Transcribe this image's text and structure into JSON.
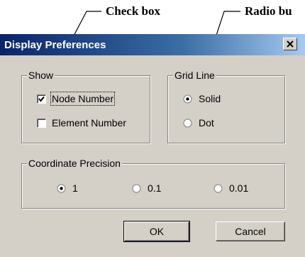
{
  "annotations": {
    "check_box_label": "Check box",
    "radio_label": "Radio bu"
  },
  "dialog": {
    "title": "Display Preferences",
    "close_glyph": "×",
    "show_group": {
      "label": "Show",
      "items": [
        {
          "label": "Node Number",
          "checked": true
        },
        {
          "label": "Element Number",
          "checked": false
        }
      ]
    },
    "grid_group": {
      "label": "Grid Line",
      "options": [
        {
          "label": "Solid",
          "selected": true
        },
        {
          "label": "Dot",
          "selected": false
        }
      ]
    },
    "precision_group": {
      "label": "Coordinate Precision",
      "options": [
        {
          "label": "1",
          "selected": true
        },
        {
          "label": "0.1",
          "selected": false
        },
        {
          "label": "0.01",
          "selected": false
        }
      ]
    },
    "ok_label": "OK",
    "cancel_label": "Cancel"
  },
  "colors": {
    "titlebar_start": "#0a246a",
    "titlebar_end": "#a6caf0",
    "dialog_face": "#d4d0c8"
  }
}
